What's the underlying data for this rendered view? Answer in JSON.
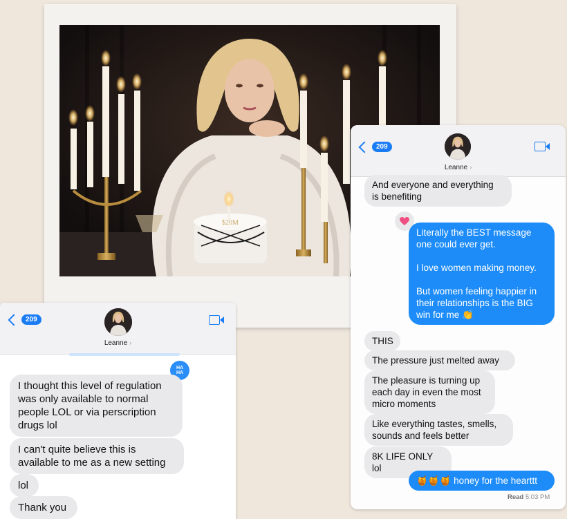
{
  "right_chat": {
    "back_count": "209",
    "contact_name": "Leanne",
    "messages": [
      {
        "from": "in",
        "text": "And everyone and everything\nis benefiting"
      },
      {
        "from": "out",
        "text": "Literally the BEST message\none could ever get.\n\nI love women making money.\n\nBut women feeling happier in\ntheir relationships is the BIG\nwin for me 👏"
      },
      {
        "from": "in",
        "text": "THIS"
      },
      {
        "from": "in",
        "text": "The pressure just melted away"
      },
      {
        "from": "in",
        "text": "The pleasure is turning up\neach day in even the most\nmicro moments"
      },
      {
        "from": "in",
        "text": "Like everything tastes, smells,\nsounds and feels better"
      },
      {
        "from": "in",
        "text": "8K LIFE ONLY lol"
      },
      {
        "from": "out",
        "text": "🍯🍯🍯 honey for the hearttt"
      }
    ],
    "read_label": "Read",
    "read_time": "5:03 PM"
  },
  "left_chat": {
    "back_count": "209",
    "contact_name": "Leanne",
    "tapback": "HA\nHA",
    "messages": [
      {
        "from": "in",
        "text": "I thought this level of regulation\nwas only available to normal\npeople LOL or via perscription\ndrugs lol"
      },
      {
        "from": "in",
        "text": "I can't quite believe this is\navailable to me as a new setting"
      },
      {
        "from": "in",
        "text": "lol"
      },
      {
        "from": "in",
        "text": "Thank you"
      }
    ]
  },
  "photo": {
    "cake_text": "$20M"
  },
  "colors": {
    "imessage_blue": "#1d8cf8",
    "incoming_gray": "#e9e9eb",
    "accent_blue": "#1a7cf5",
    "background": "#efe6dc"
  },
  "icons": [
    "chevron-left-icon",
    "video-camera-icon",
    "haha-tapback-icon",
    "heart-tapback-icon"
  ]
}
